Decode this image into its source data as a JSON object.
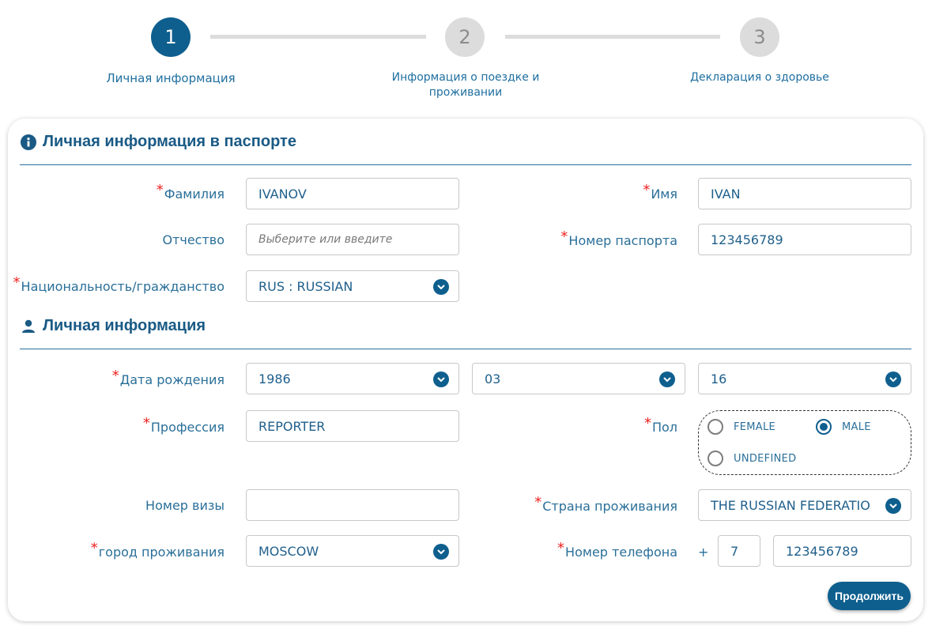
{
  "stepper": {
    "steps": [
      {
        "number": "1",
        "label": "Личная информация",
        "state": "active"
      },
      {
        "number": "2",
        "label": "Информация о поездке и проживании",
        "state": "inactive"
      },
      {
        "number": "3",
        "label": "Декларация о здоровье",
        "state": "inactive"
      }
    ]
  },
  "passport_section": {
    "title": "Личная информация в паспорте",
    "icon": "info-icon",
    "fields": {
      "surname": {
        "label": "Фамилия",
        "required": true,
        "value": "IVANOV"
      },
      "name": {
        "label": "Имя",
        "required": true,
        "value": "IVAN"
      },
      "patronymic": {
        "label": "Отчество",
        "required": false,
        "value": "",
        "placeholder": "Выберите или введите"
      },
      "passport_number": {
        "label": "Номер паспорта",
        "required": true,
        "value": "123456789"
      },
      "nationality": {
        "label": "Национальность/гражданство",
        "required": true,
        "value": "RUS : RUSSIAN"
      }
    }
  },
  "personal_section": {
    "title": "Личная информация",
    "icon": "user-icon",
    "fields": {
      "birth_date": {
        "label": "Дата рождения",
        "required": true,
        "year": "1986",
        "month": "03",
        "day": "16"
      },
      "profession": {
        "label": "Профессия",
        "required": true,
        "value": "REPORTER"
      },
      "gender": {
        "label": "Пол",
        "required": true,
        "options": [
          "FEMALE",
          "MALE",
          "UNDEFINED"
        ],
        "selected": "MALE"
      },
      "visa_number": {
        "label": "Номер визы",
        "required": false,
        "value": ""
      },
      "residence_country": {
        "label": "Страна проживания",
        "required": true,
        "value": "THE RUSSIAN FEDERATION"
      },
      "residence_city": {
        "label": "город проживания",
        "required": true,
        "value": "MOSCOW"
      },
      "phone": {
        "label": "Номер телефона",
        "required": true,
        "plus": "+",
        "country_code": "7",
        "number": "123456789"
      }
    }
  },
  "actions": {
    "continue_label": "Продолжить"
  },
  "colors": {
    "primary": "#0e5f8e",
    "text": "#2a6f99",
    "required": "#e22222",
    "inactive": "#dcdcdc"
  }
}
